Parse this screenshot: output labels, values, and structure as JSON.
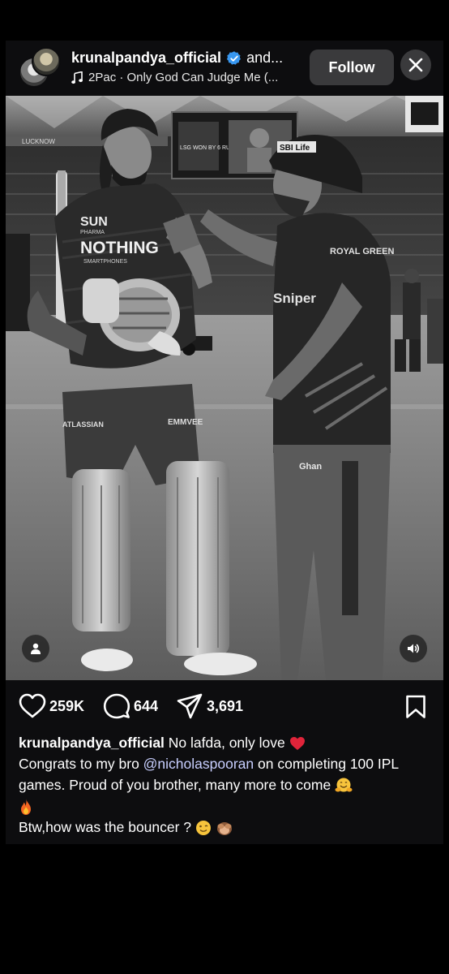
{
  "header": {
    "username": "krunalpandya_official",
    "coauthor_suffix": "and...",
    "audio": "2Pac · Only God Can Judge Me (...",
    "follow_label": "Follow"
  },
  "media": {
    "photo_text": {
      "sponsor_1": "SUN",
      "sponsor_1_sub": "PHARMA",
      "sponsor_2": "NOTHING",
      "sponsor_2_sub": "SMARTPHONES",
      "sponsor_3": "ATLASSIAN",
      "sponsor_4": "EMMVEE",
      "cap_text": "SBI Life",
      "scoreboard": "LSG WON BY 6 RUNS",
      "ad_board": "LUCKNOW",
      "shoulder_brand": "ROYAL GREEN",
      "chest_brand": "Sniper",
      "pants_brand": "Ghan"
    }
  },
  "actions": {
    "likes": "259K",
    "comments": "644",
    "shares": "3,691"
  },
  "caption": {
    "username": "krunalpandya_official",
    "text_1": "No lafda, only love",
    "text_2_pre": "Congrats to my bro ",
    "mention": "@nicholaspooran",
    "text_2_post": " on completing 100 IPL games. Proud of you brother, many more to come",
    "text_3": "Btw,how was the bouncer ?"
  },
  "icons": {
    "verified": "verified-badge-icon",
    "music": "music-note-icon",
    "close": "close-icon",
    "user_tag": "user-tag-icon",
    "audio": "speaker-icon",
    "like": "heart-icon",
    "comment": "comment-icon",
    "share": "send-icon",
    "save": "bookmark-icon"
  },
  "colors": {
    "background": "#000000",
    "card": "#0d0d0f",
    "button": "#3a3a3c",
    "verified": "#3897f0",
    "mention": "#c8cfff",
    "heart_emoji": "#e0243a"
  }
}
